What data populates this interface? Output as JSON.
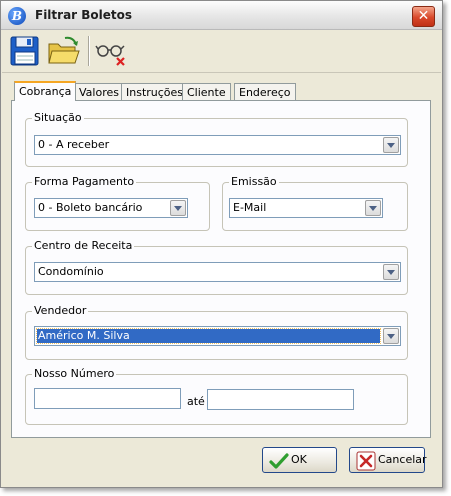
{
  "window": {
    "title": "Filtrar Boletos",
    "app_icon_glyph": "B",
    "close_glyph": "✕"
  },
  "toolbar": {
    "save_icon": "save-icon",
    "open_icon": "open-folder-icon",
    "clear_icon": "clear-filter-icon"
  },
  "tabs": [
    {
      "label": "Cobrança",
      "active": true
    },
    {
      "label": "Valores",
      "active": false
    },
    {
      "label": "Instruções",
      "active": false
    },
    {
      "label": "Cliente",
      "active": false
    },
    {
      "label": "Endereço",
      "active": false
    }
  ],
  "form": {
    "situacao": {
      "legend": "Situação",
      "value": "0 - A receber"
    },
    "forma_pagamento": {
      "legend": "Forma Pagamento",
      "value": "0 - Boleto bancário"
    },
    "emissao": {
      "legend": "Emissão",
      "value": "E-Mail"
    },
    "centro_receita": {
      "legend": "Centro de Receita",
      "value": "Condomínio"
    },
    "vendedor": {
      "legend": "Vendedor",
      "value": "Américo M. Silva"
    },
    "nosso_numero": {
      "legend": "Nosso Número",
      "from_value": "",
      "to_value": "",
      "separator": "até"
    }
  },
  "buttons": {
    "ok_label": "OK",
    "cancel_label": "Cancelar"
  },
  "colors": {
    "selection": "#316ac5",
    "tab_highlight": "#f5a623",
    "ok_check": "#2f9e2f",
    "cancel_x": "#c62828"
  }
}
